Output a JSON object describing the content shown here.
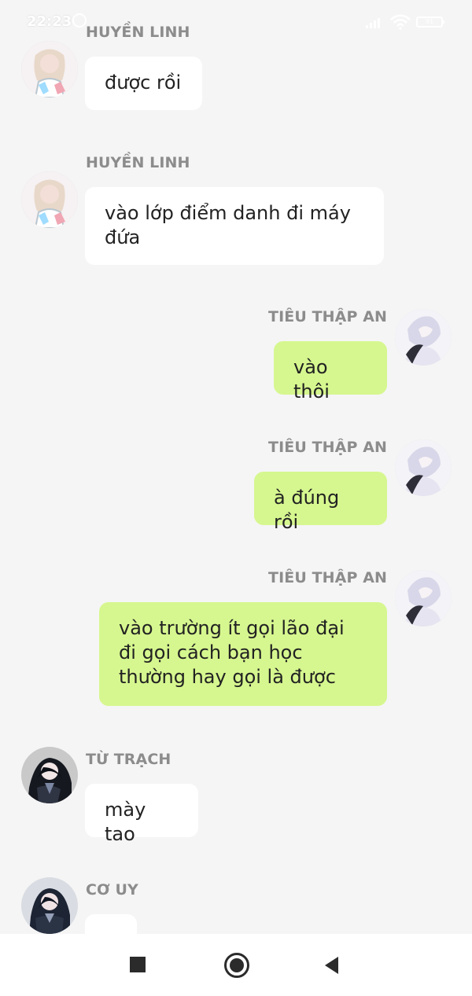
{
  "status_bar": {
    "time": "22:23",
    "battery_label": "91"
  },
  "messages": [
    {
      "side": "left",
      "sender": "HUYỀN LINH",
      "text": "được rồi",
      "avatar_icon": "girl-avatar-icon"
    },
    {
      "side": "left",
      "sender": "HUYỀN LINH",
      "text": "vào lớp điểm danh đi máy đứa",
      "avatar_icon": "girl-avatar-icon"
    },
    {
      "side": "right",
      "sender": "TIÊU THẬP AN",
      "text": "vào thôi",
      "avatar_icon": "boy-avatar-icon"
    },
    {
      "side": "right",
      "sender": "TIÊU THẬP AN",
      "text": "à đúng rồi",
      "avatar_icon": "boy-avatar-icon"
    },
    {
      "side": "right",
      "sender": "TIÊU THẬP AN",
      "text": "vào trường ít gọi lão đại đi gọi cách bạn học thường hay gọi là được",
      "avatar_icon": "boy-avatar-icon"
    },
    {
      "side": "left",
      "sender": "TỪ TRẠCH",
      "text": "mày tao",
      "avatar_icon": "dark-hair-avatar-icon"
    },
    {
      "side": "left",
      "sender": "CƠ UY",
      "text": "...",
      "avatar_icon": "dark-hair-avatar-icon"
    }
  ],
  "colors": {
    "background": "#f5f5f5",
    "left_bubble": "#ffffff",
    "right_bubble": "#d6f78f",
    "sender_text": "#8c8c8c",
    "message_text": "#222222"
  },
  "nav_bar": {
    "buttons": [
      "recent-apps-icon",
      "home-icon",
      "back-icon"
    ]
  }
}
